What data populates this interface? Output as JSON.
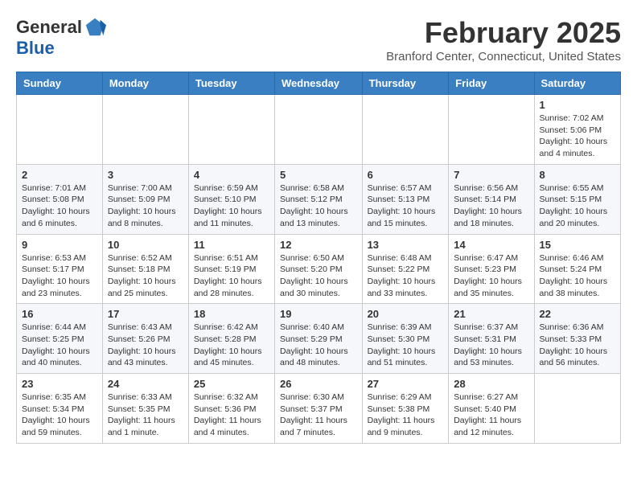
{
  "logo": {
    "general": "General",
    "blue": "Blue"
  },
  "title": "February 2025",
  "location": "Branford Center, Connecticut, United States",
  "days_of_week": [
    "Sunday",
    "Monday",
    "Tuesday",
    "Wednesday",
    "Thursday",
    "Friday",
    "Saturday"
  ],
  "weeks": [
    [
      {
        "day": "",
        "info": ""
      },
      {
        "day": "",
        "info": ""
      },
      {
        "day": "",
        "info": ""
      },
      {
        "day": "",
        "info": ""
      },
      {
        "day": "",
        "info": ""
      },
      {
        "day": "",
        "info": ""
      },
      {
        "day": "1",
        "info": "Sunrise: 7:02 AM\nSunset: 5:06 PM\nDaylight: 10 hours\nand 4 minutes."
      }
    ],
    [
      {
        "day": "2",
        "info": "Sunrise: 7:01 AM\nSunset: 5:08 PM\nDaylight: 10 hours\nand 6 minutes."
      },
      {
        "day": "3",
        "info": "Sunrise: 7:00 AM\nSunset: 5:09 PM\nDaylight: 10 hours\nand 8 minutes."
      },
      {
        "day": "4",
        "info": "Sunrise: 6:59 AM\nSunset: 5:10 PM\nDaylight: 10 hours\nand 11 minutes."
      },
      {
        "day": "5",
        "info": "Sunrise: 6:58 AM\nSunset: 5:12 PM\nDaylight: 10 hours\nand 13 minutes."
      },
      {
        "day": "6",
        "info": "Sunrise: 6:57 AM\nSunset: 5:13 PM\nDaylight: 10 hours\nand 15 minutes."
      },
      {
        "day": "7",
        "info": "Sunrise: 6:56 AM\nSunset: 5:14 PM\nDaylight: 10 hours\nand 18 minutes."
      },
      {
        "day": "8",
        "info": "Sunrise: 6:55 AM\nSunset: 5:15 PM\nDaylight: 10 hours\nand 20 minutes."
      }
    ],
    [
      {
        "day": "9",
        "info": "Sunrise: 6:53 AM\nSunset: 5:17 PM\nDaylight: 10 hours\nand 23 minutes."
      },
      {
        "day": "10",
        "info": "Sunrise: 6:52 AM\nSunset: 5:18 PM\nDaylight: 10 hours\nand 25 minutes."
      },
      {
        "day": "11",
        "info": "Sunrise: 6:51 AM\nSunset: 5:19 PM\nDaylight: 10 hours\nand 28 minutes."
      },
      {
        "day": "12",
        "info": "Sunrise: 6:50 AM\nSunset: 5:20 PM\nDaylight: 10 hours\nand 30 minutes."
      },
      {
        "day": "13",
        "info": "Sunrise: 6:48 AM\nSunset: 5:22 PM\nDaylight: 10 hours\nand 33 minutes."
      },
      {
        "day": "14",
        "info": "Sunrise: 6:47 AM\nSunset: 5:23 PM\nDaylight: 10 hours\nand 35 minutes."
      },
      {
        "day": "15",
        "info": "Sunrise: 6:46 AM\nSunset: 5:24 PM\nDaylight: 10 hours\nand 38 minutes."
      }
    ],
    [
      {
        "day": "16",
        "info": "Sunrise: 6:44 AM\nSunset: 5:25 PM\nDaylight: 10 hours\nand 40 minutes."
      },
      {
        "day": "17",
        "info": "Sunrise: 6:43 AM\nSunset: 5:26 PM\nDaylight: 10 hours\nand 43 minutes."
      },
      {
        "day": "18",
        "info": "Sunrise: 6:42 AM\nSunset: 5:28 PM\nDaylight: 10 hours\nand 45 minutes."
      },
      {
        "day": "19",
        "info": "Sunrise: 6:40 AM\nSunset: 5:29 PM\nDaylight: 10 hours\nand 48 minutes."
      },
      {
        "day": "20",
        "info": "Sunrise: 6:39 AM\nSunset: 5:30 PM\nDaylight: 10 hours\nand 51 minutes."
      },
      {
        "day": "21",
        "info": "Sunrise: 6:37 AM\nSunset: 5:31 PM\nDaylight: 10 hours\nand 53 minutes."
      },
      {
        "day": "22",
        "info": "Sunrise: 6:36 AM\nSunset: 5:33 PM\nDaylight: 10 hours\nand 56 minutes."
      }
    ],
    [
      {
        "day": "23",
        "info": "Sunrise: 6:35 AM\nSunset: 5:34 PM\nDaylight: 10 hours\nand 59 minutes."
      },
      {
        "day": "24",
        "info": "Sunrise: 6:33 AM\nSunset: 5:35 PM\nDaylight: 11 hours\nand 1 minute."
      },
      {
        "day": "25",
        "info": "Sunrise: 6:32 AM\nSunset: 5:36 PM\nDaylight: 11 hours\nand 4 minutes."
      },
      {
        "day": "26",
        "info": "Sunrise: 6:30 AM\nSunset: 5:37 PM\nDaylight: 11 hours\nand 7 minutes."
      },
      {
        "day": "27",
        "info": "Sunrise: 6:29 AM\nSunset: 5:38 PM\nDaylight: 11 hours\nand 9 minutes."
      },
      {
        "day": "28",
        "info": "Sunrise: 6:27 AM\nSunset: 5:40 PM\nDaylight: 11 hours\nand 12 minutes."
      },
      {
        "day": "",
        "info": ""
      }
    ]
  ]
}
